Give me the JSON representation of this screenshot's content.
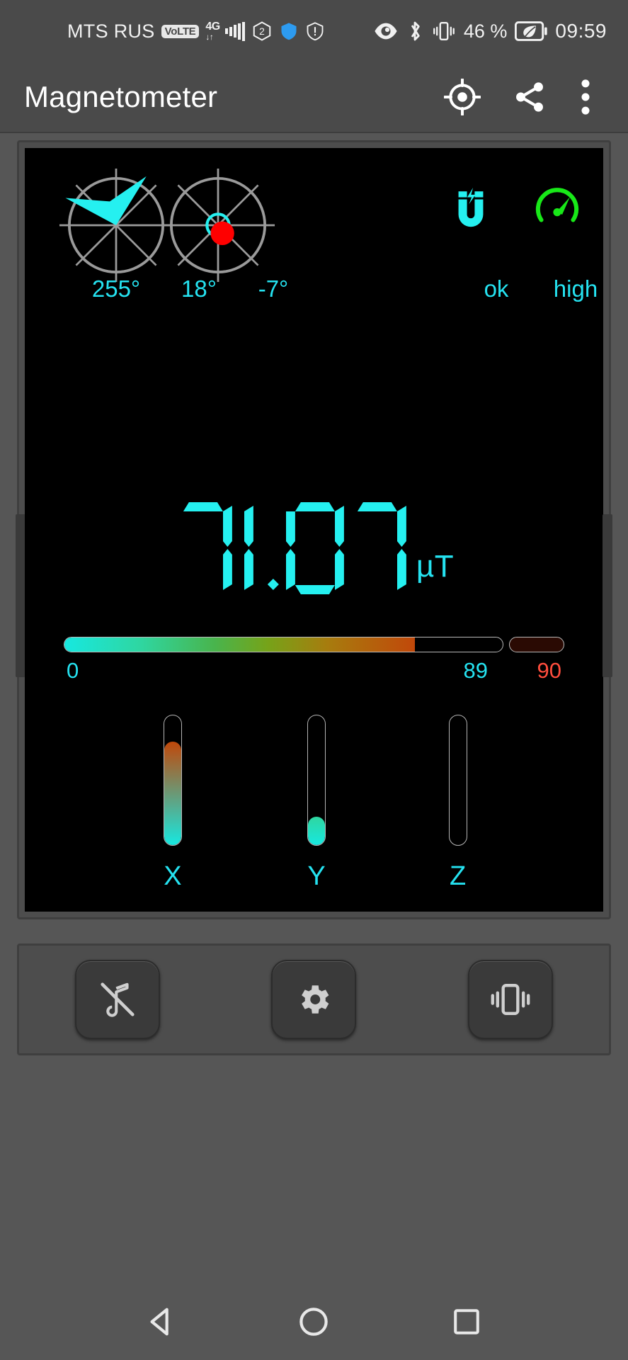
{
  "statusbar": {
    "carrier": "MTS RUS",
    "volte_badge": "VoLTE",
    "network_type": "4G",
    "network_plus": "+",
    "network_sub": "↓↑",
    "sim_indicator": "2",
    "battery_percent": "46 %",
    "clock": "09:59",
    "icons": {
      "eye": "eye-icon",
      "bluetooth": "bluetooth-icon",
      "vibrate": "vibrate-icon",
      "battery_saver": "battery-saver-leaf-icon",
      "shield": "shield-icon",
      "warning": "warning-icon",
      "signal": "signal-bars-icon"
    }
  },
  "appbar": {
    "title": "Magnetometer",
    "calibrate_icon": "crosshair-target-icon",
    "share_icon": "share-icon",
    "overflow_icon": "more-vertical-icon"
  },
  "display": {
    "compass": {
      "heading_label": "255°",
      "heading_degrees": 255,
      "needle_color": "#25f0f0",
      "dial_color": "#9a9a9a"
    },
    "tilt": {
      "pitch_label": "18°",
      "roll_label": "-7°",
      "pitch_degrees": 18,
      "roll_degrees": -7,
      "bubble_color": "#25f0f0",
      "dot_color": "#ff0000"
    },
    "sensor_status": {
      "magnet_icon": "magnet-icon",
      "magnet_label": "ok",
      "magnet_color": "#25f0f0",
      "accuracy_icon": "speedometer-icon",
      "accuracy_label": "high",
      "accuracy_color": "#18e818",
      "accuracy_text_color": "#25e2f0"
    },
    "reading": {
      "value": "71.07",
      "digits": [
        "7",
        "1",
        ".",
        "0",
        "7"
      ],
      "unit": "µT",
      "color": "#25f0f0"
    },
    "scale": {
      "min_label": "0",
      "max_label": "89",
      "over_label": "90",
      "min_value": 0,
      "max_value": 89,
      "fill_percent": 80,
      "over_color": "#ff4d3d"
    },
    "axes": [
      {
        "name": "X",
        "value": "68.12",
        "fill_percent": 80,
        "top_color": "#c1480a",
        "bottom_color": "#17e8e0"
      },
      {
        "name": "Y",
        "value": "-20.19",
        "fill_percent": 22,
        "top_color": "#2fd6a0",
        "bottom_color": "#17e8e0"
      },
      {
        "name": "Z",
        "value": "-1.38",
        "fill_percent": 0,
        "top_color": "#17e8e0",
        "bottom_color": "#17e8e0"
      }
    ]
  },
  "buttons": {
    "sound_off": "sound-off-icon",
    "settings": "settings-gear-icon",
    "vibrate": "vibrate-alert-icon"
  },
  "navbar": {
    "back": "back-triangle-icon",
    "home": "home-circle-icon",
    "recents": "recents-square-icon"
  }
}
